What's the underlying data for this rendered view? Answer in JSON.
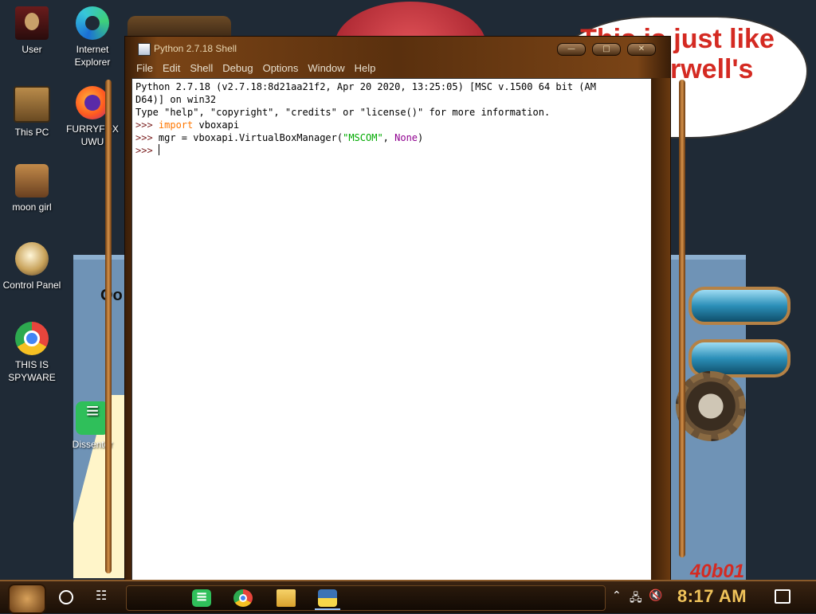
{
  "wallpaper": {
    "speech_line1": "This is just like",
    "speech_line2": "Orwell's",
    "poster_left_text": "Oo",
    "poster_bottom_text": "40b01"
  },
  "desktop_icons": [
    {
      "label": "User"
    },
    {
      "label": "Internet\nExplorer"
    },
    {
      "label": "This PC"
    },
    {
      "label": "FURRYFOX\nUWU"
    },
    {
      "label": "moon girl"
    },
    {
      "label": "Control Panel"
    },
    {
      "label": "THIS IS\nSPYWARE"
    },
    {
      "label": "Dissenter"
    }
  ],
  "window": {
    "title": "Python 2.7.18 Shell",
    "buttons": {
      "minimize": "—",
      "maximize": "□",
      "close": "✕"
    },
    "menu": [
      "File",
      "Edit",
      "Shell",
      "Debug",
      "Options",
      "Window",
      "Help"
    ],
    "shell": {
      "banner1": "Python 2.7.18 (v2.7.18:8d21aa21f2, Apr 20 2020, 13:25:05) [MSC v.1500 64 bit (AM",
      "banner2": "D64)] on win32",
      "banner3": "Type \"help\", \"copyright\", \"credits\" or \"license()\" for more information.",
      "prompt": ">>> ",
      "line1_kw": "import",
      "line1_rest": " vboxapi",
      "line2_a": "mgr = vboxapi.VirtualBoxManager(",
      "line2_str": "\"MSCOM\"",
      "line2_b": ", ",
      "line2_none": "None",
      "line2_c": ")"
    }
  },
  "taskbar": {
    "clock": "8:17 AM",
    "apps": [
      "Dissenter",
      "Chrome",
      "File Explorer",
      "Python IDLE"
    ],
    "icons": {
      "start": "gear-start-icon",
      "search": "cortana-circle-icon",
      "taskview": "task-view-icon",
      "network": "network-icon",
      "volume": "volume-muted-icon",
      "notifications": "notification-icon"
    }
  }
}
